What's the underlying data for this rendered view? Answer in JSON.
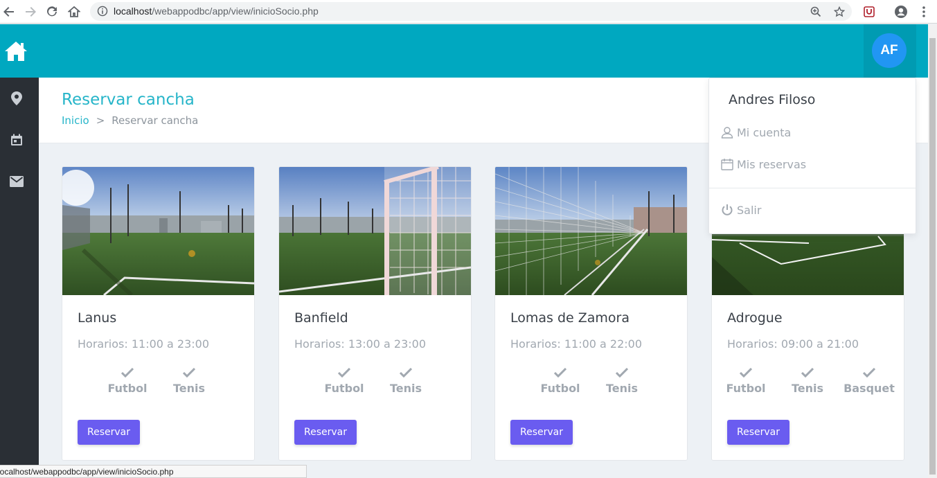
{
  "browser": {
    "url_host": "localhost",
    "url_path": "/webappodbc/app/view/inicioSocio.php",
    "status_url": "localhost/webappodbc/app/view/inicioSocio.php"
  },
  "header": {
    "avatar_initials": "AF",
    "brand_color": "#00a8c0"
  },
  "sidebar": {
    "items": [
      {
        "icon": "map-pin-icon"
      },
      {
        "icon": "calendar-icon"
      },
      {
        "icon": "mail-icon"
      }
    ]
  },
  "page": {
    "title": "Reservar cancha",
    "breadcrumb": {
      "home": "Inicio",
      "separator": ">",
      "current": "Reservar cancha"
    }
  },
  "cards": [
    {
      "name": "Lanus",
      "hours": "Horarios: 11:00 a 23:00",
      "sports": [
        "Futbol",
        "Tenis"
      ],
      "button": "Reservar"
    },
    {
      "name": "Banfield",
      "hours": "Horarios: 13:00 a 23:00",
      "sports": [
        "Futbol",
        "Tenis"
      ],
      "button": "Reservar"
    },
    {
      "name": "Lomas de Zamora",
      "hours": "Horarios: 11:00 a 22:00",
      "sports": [
        "Futbol",
        "Tenis"
      ],
      "button": "Reservar"
    },
    {
      "name": "Adrogue",
      "hours": "Horarios: 09:00 a 21:00",
      "sports": [
        "Futbol",
        "Tenis",
        "Basquet"
      ],
      "button": "Reservar"
    }
  ],
  "user_menu": {
    "name": "Andres Filoso",
    "items": [
      {
        "label": "Mi cuenta",
        "icon": "user-icon"
      },
      {
        "label": "Mis reservas",
        "icon": "calendar-icon"
      },
      {
        "label": "Salir",
        "icon": "power-icon"
      }
    ]
  },
  "colors": {
    "accent": "#26b5c9",
    "button": "#6a5cf0",
    "avatar": "#2196f3",
    "sidebar": "#2a2f35"
  }
}
